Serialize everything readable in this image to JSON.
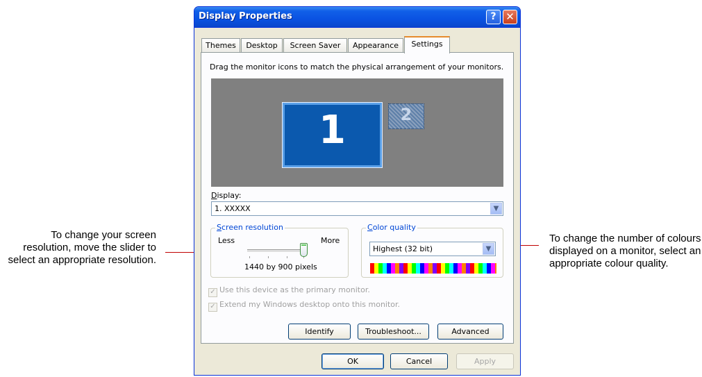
{
  "annotations": {
    "left": "To change your screen resolution, move the slider to select an appropriate resolution.",
    "right": "To change the number of colours displayed on a monitor, select an appropriate colour quality."
  },
  "window": {
    "title": "Display Properties",
    "help_glyph": "?",
    "close_glyph": "✕"
  },
  "tabs": [
    "Themes",
    "Desktop",
    "Screen Saver",
    "Appearance",
    "Settings"
  ],
  "active_tab": "Settings",
  "settings": {
    "instruction": "Drag the monitor icons to match the physical arrangement of your monitors.",
    "monitors": [
      {
        "label": "1",
        "selected": true
      },
      {
        "label": "2",
        "selected": false
      }
    ],
    "display_label": "Display:",
    "display_value": "1. XXXXX",
    "resolution": {
      "group_title": "Screen resolution",
      "less": "Less",
      "more": "More",
      "slider_level": 1.0,
      "value": "1440 by 900 pixels"
    },
    "color_quality": {
      "group_title": "Color quality",
      "value": "Highest (32 bit)"
    },
    "checkboxes": [
      {
        "label": "Use this device as the primary monitor.",
        "checked": true,
        "disabled": true
      },
      {
        "label": "Extend my Windows desktop onto this monitor.",
        "checked": true,
        "disabled": true
      }
    ],
    "buttons": {
      "identify": "Identify",
      "troubleshoot": "Troubleshoot...",
      "advanced": "Advanced"
    }
  },
  "footer": {
    "ok": "OK",
    "cancel": "Cancel",
    "apply": "Apply"
  },
  "colors": {
    "titlebar": "#0a52e2",
    "leader_line": "#c00000",
    "tab_highlight": "#e68b2c"
  }
}
